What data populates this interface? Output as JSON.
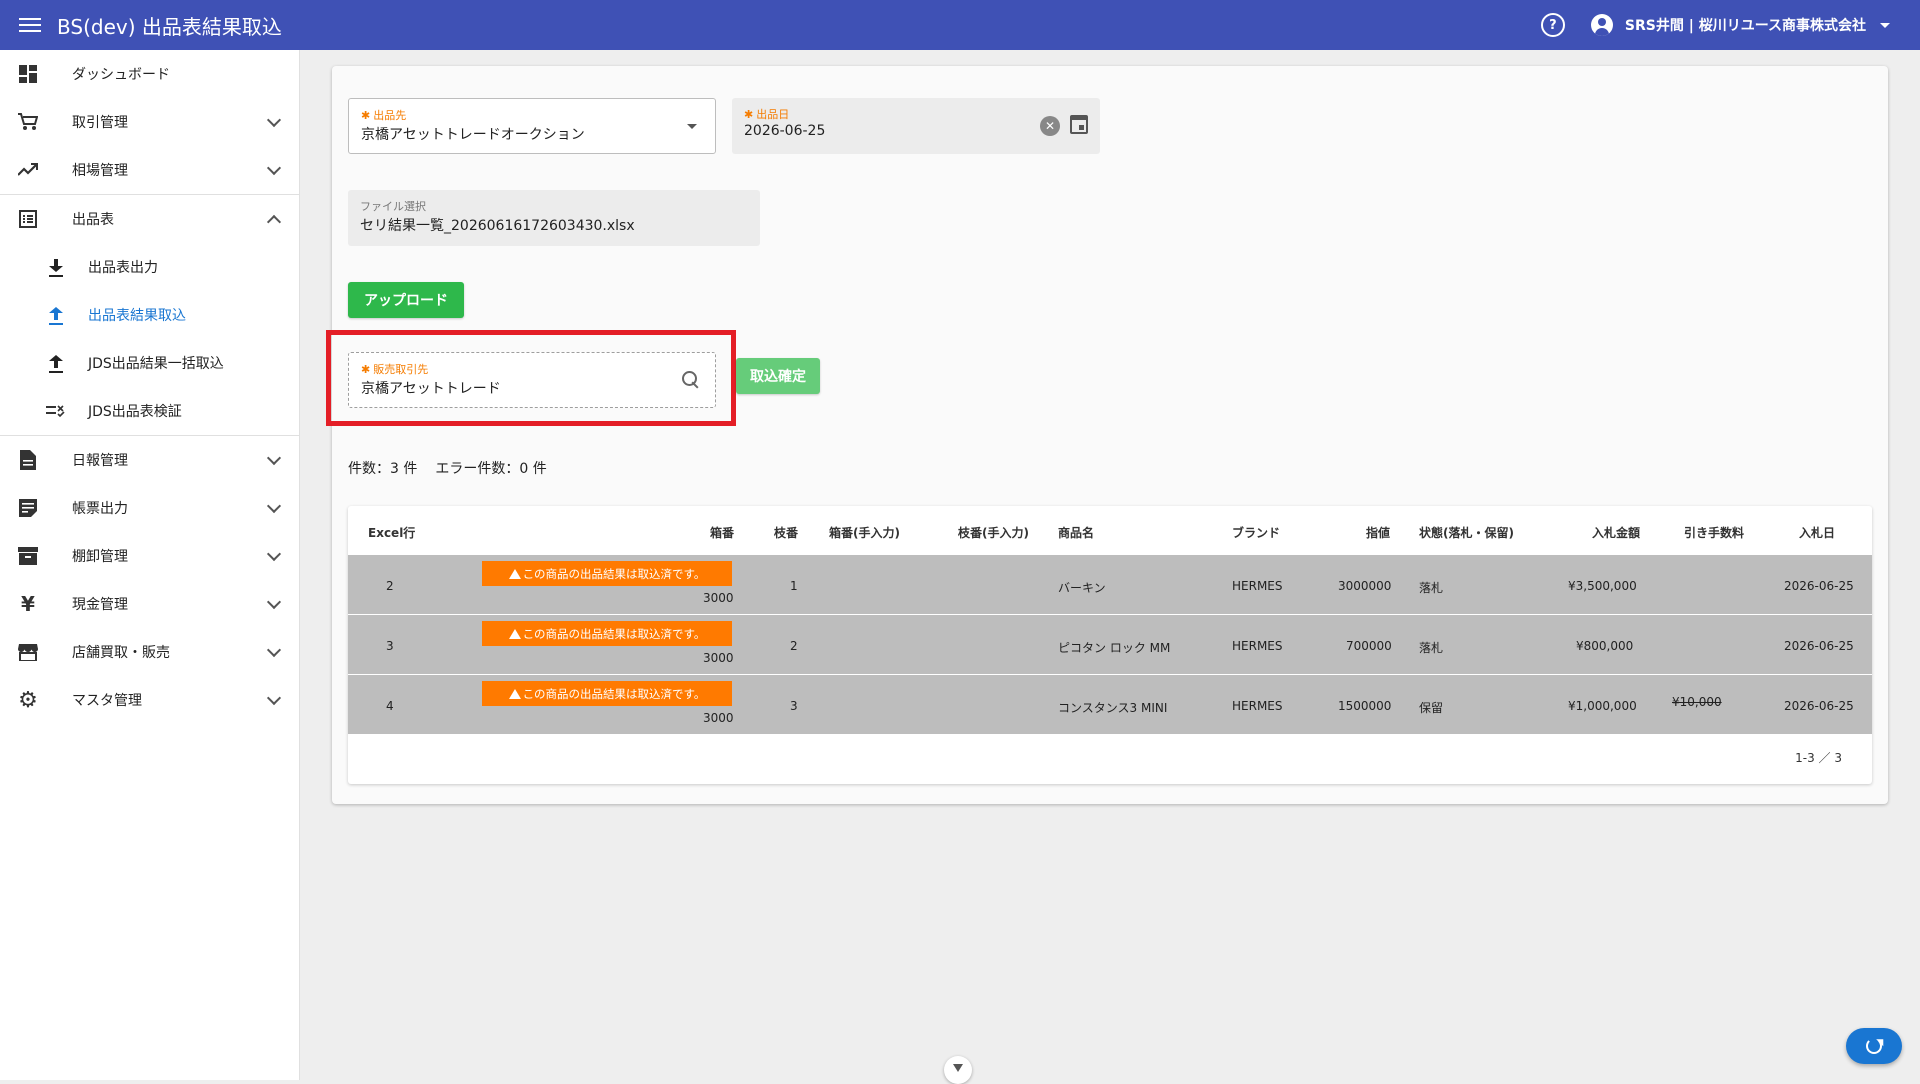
{
  "app": {
    "title": "BS(dev) 出品表結果取込",
    "user_name": "SRS井間 | 桜川リユース商事株式会社"
  },
  "sidebar": {
    "items": [
      {
        "label": "ダッシュボード",
        "icon": "dashboard-icon"
      },
      {
        "label": "取引管理",
        "icon": "cart-icon"
      },
      {
        "label": "相場管理",
        "icon": "trending-up-icon"
      },
      {
        "label": "出品表",
        "icon": "list-icon"
      }
    ],
    "sub_items": [
      {
        "label": "出品表出力",
        "icon": "download-icon"
      },
      {
        "label": "出品表結果取込",
        "icon": "upload-icon"
      },
      {
        "label": "JDS出品結果一括取込",
        "icon": "upload-icon"
      },
      {
        "label": "JDS出品表検証",
        "icon": "checklist-icon"
      }
    ],
    "items2": [
      {
        "label": "日報管理",
        "icon": "document-icon"
      },
      {
        "label": "帳票出力",
        "icon": "note-icon"
      },
      {
        "label": "棚卸管理",
        "icon": "archive-icon"
      },
      {
        "label": "現金管理",
        "icon": "yen-icon"
      },
      {
        "label": "店舗買取・販売",
        "icon": "store-icon"
      },
      {
        "label": "マスタ管理",
        "icon": "gear-icon"
      }
    ]
  },
  "form": {
    "shuppinsaki_label": "出品先",
    "shuppinsaki_value": "京橋アセットトレードオークション",
    "shuppinbi_label": "出品日",
    "shuppinbi_value": "2026-06-25",
    "file_label": "ファイル選択",
    "file_value": "セリ結果一覧_20260616172603430.xlsx",
    "upload_label": "アップロード",
    "hanbai_label": "販売取引先",
    "hanbai_value": "京橋アセットトレード",
    "confirm_label": "取込確定",
    "required_mark": "✱"
  },
  "counts": {
    "total": "件数：3 件",
    "errors": "エラー件数：0 件"
  },
  "table": {
    "headers": [
      "Excel行",
      "箱番",
      "枝番",
      "箱番(手入力)",
      "枝番(手入力)",
      "商品名",
      "ブランド",
      "指値",
      "状態(落札・保留)",
      "入札金額",
      "引き手数料",
      "入札日"
    ],
    "warning_text": "この商品の出品結果は取込済です。",
    "rows": [
      {
        "excel_row": "2",
        "hako": "3000",
        "eda": "1",
        "name": "バーキン",
        "brand": "HERMES",
        "sashine": "3000000",
        "status": "落札",
        "amount": "¥3,500,000",
        "fee": "",
        "date": "2026-06-25"
      },
      {
        "excel_row": "3",
        "hako": "3000",
        "eda": "2",
        "name": "ピコタン ロック MM",
        "brand": "HERMES",
        "sashine": "700000",
        "status": "落札",
        "amount": "¥800,000",
        "fee": "",
        "date": "2026-06-25"
      },
      {
        "excel_row": "4",
        "hako": "3000",
        "eda": "3",
        "name": "コンスタンス3 MINI",
        "brand": "HERMES",
        "sashine": "1500000",
        "status": "保留",
        "amount": "¥1,000,000",
        "fee": "¥10,000",
        "date": "2026-06-25"
      }
    ],
    "pagination": "1-3 ／ 3"
  },
  "colors": {
    "appbar": "#3f51b5",
    "upload_button": "#2eb84b",
    "confirm_button": "#66cc7a",
    "warning": "#ff7a00",
    "highlight": "#e41e26",
    "active_nav": "#1976d2"
  }
}
